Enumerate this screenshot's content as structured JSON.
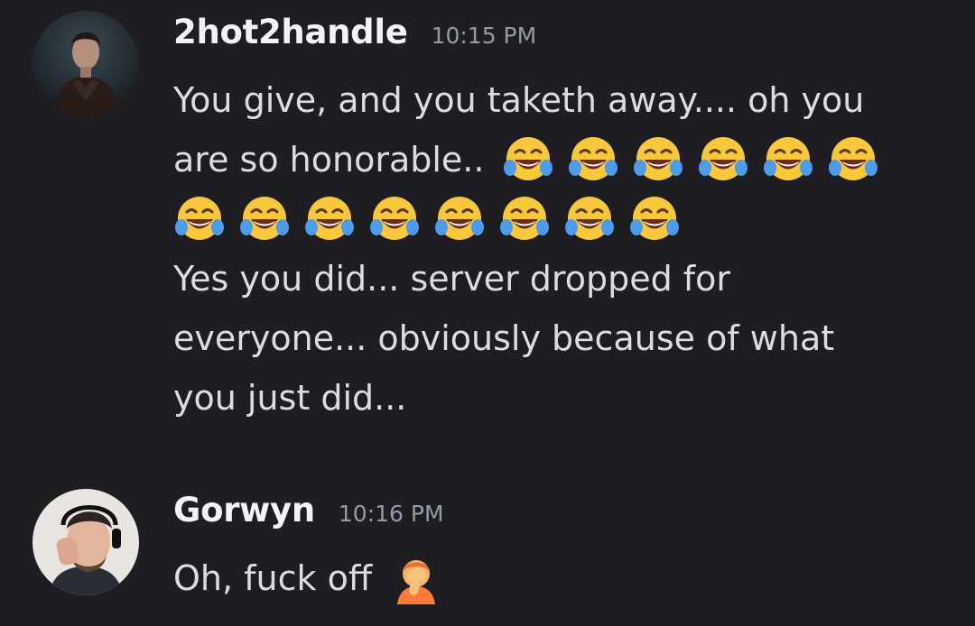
{
  "messages": [
    {
      "username": "2hot2handle",
      "timestamp": "10:15 PM",
      "avatar_icon": "user-avatar-dark-jacket",
      "lines": {
        "line1": "You give, and you taketh away.... oh you",
        "line2": "are so honorable..",
        "line4": "Yes you did... server dropped for",
        "line5": "everyone... obviously because of what",
        "line6": "you just did..."
      },
      "inline_emoji": "face-with-tears-of-joy",
      "inline_emoji_count": 6,
      "emoji_row_count": 8
    },
    {
      "username": "Gorwyn",
      "timestamp": "10:16 PM",
      "avatar_icon": "user-avatar-facepalm-headset",
      "lines": {
        "line1": "Oh, fuck off"
      },
      "emoji": "person-facepalming"
    }
  ],
  "colors": {
    "background": "#1d1d22",
    "username": "#f2f3f5",
    "timestamp": "#949ba4",
    "message_text": "#dbdee1"
  }
}
